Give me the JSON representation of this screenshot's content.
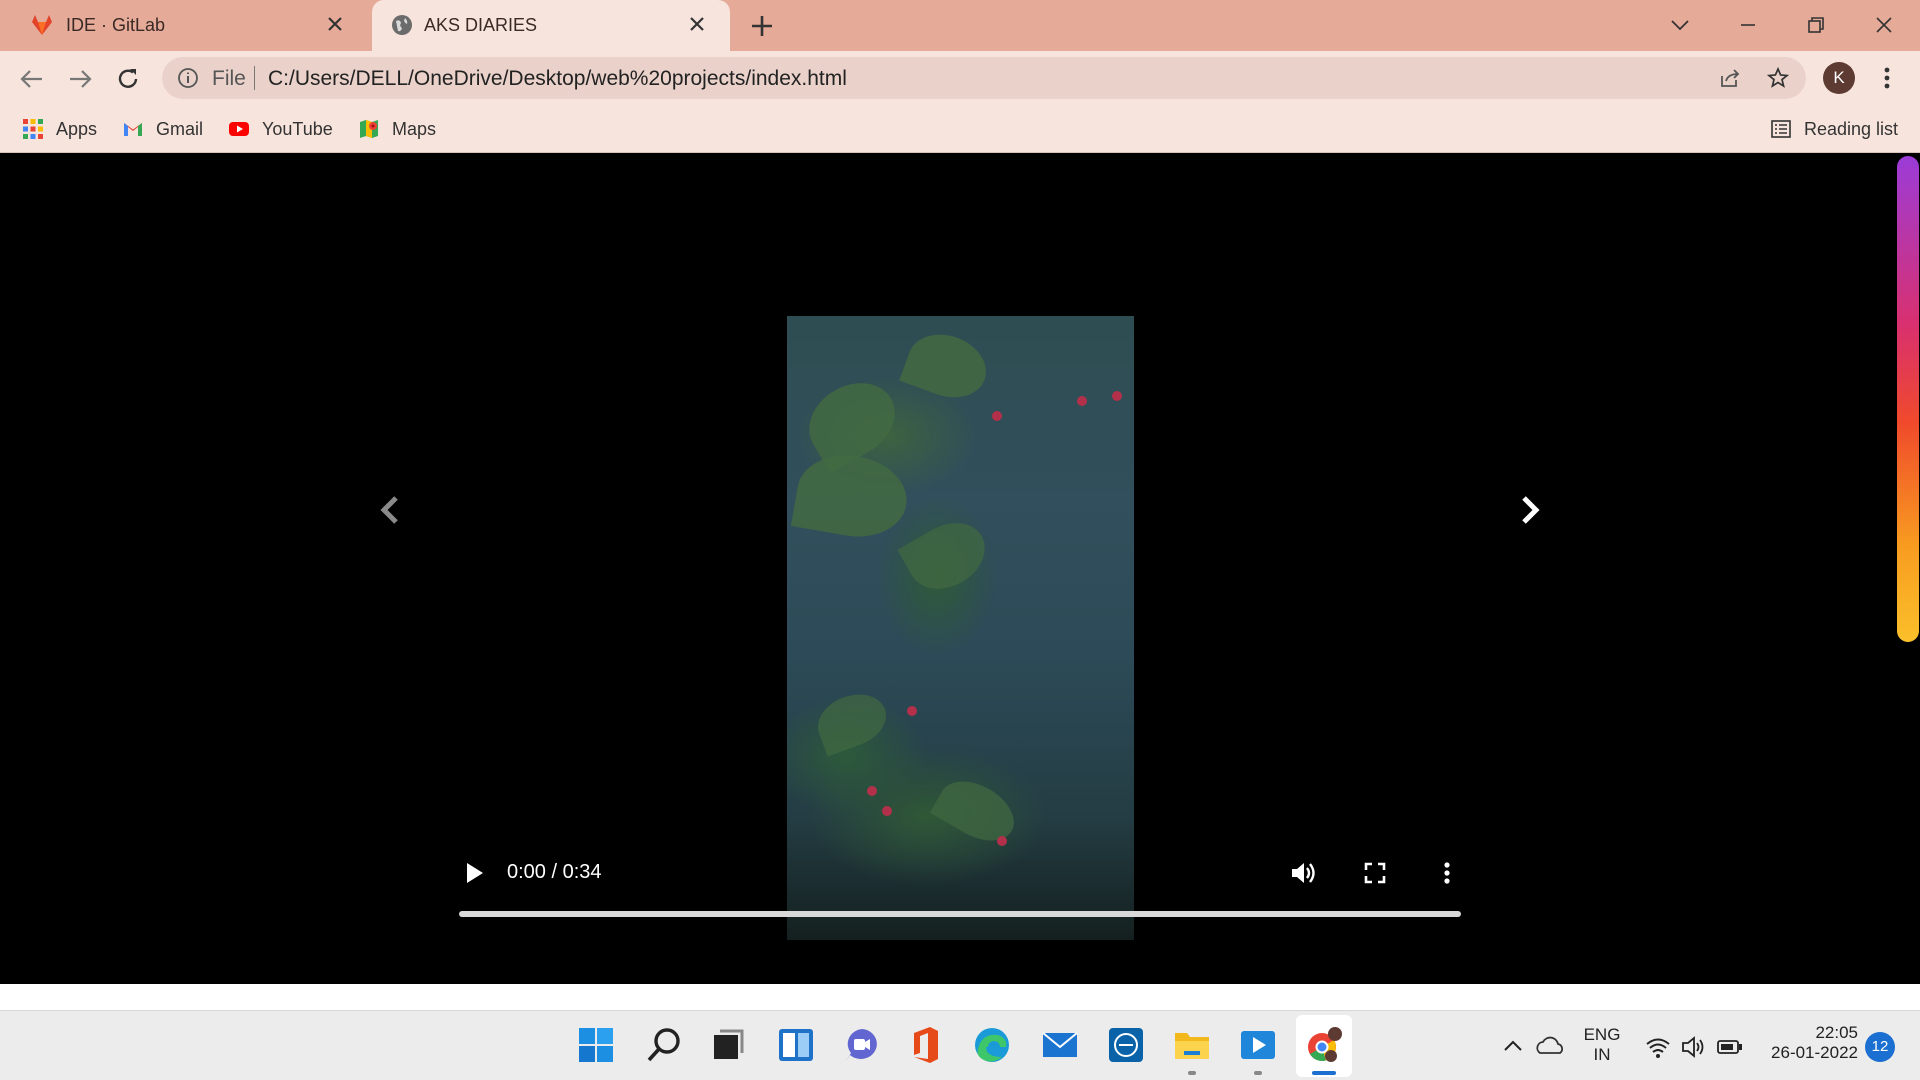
{
  "tabs": [
    {
      "title": "IDE · GitLab",
      "favicon": "gitlab-icon",
      "active": false
    },
    {
      "title": "AKS DIARIES",
      "favicon": "globe-icon",
      "active": true
    }
  ],
  "address_bar": {
    "scheme_label": "File",
    "url": "C:/Users/DELL/OneDrive/Desktop/web%20projects/index.html"
  },
  "profile": {
    "initial": "K"
  },
  "bookmarks": [
    {
      "label": "Apps",
      "icon": "apps-grid-icon"
    },
    {
      "label": "Gmail",
      "icon": "gmail-icon"
    },
    {
      "label": "YouTube",
      "icon": "youtube-icon"
    },
    {
      "label": "Maps",
      "icon": "maps-icon"
    }
  ],
  "reading_list": {
    "label": "Reading list"
  },
  "video": {
    "current_time": "0:00",
    "separator": " / ",
    "duration": "0:34",
    "progress": 0.0
  },
  "taskbar": {
    "apps": [
      "start-icon",
      "search-icon",
      "task-view-icon",
      "widgets-icon",
      "teams-chat-icon",
      "office-icon",
      "edge-icon",
      "mail-icon",
      "dell-icon",
      "file-explorer-icon",
      "media-player-icon",
      "chrome-icon"
    ]
  },
  "tray": {
    "language_top": "ENG",
    "language_bottom": "IN",
    "time": "22:05",
    "date": "26-01-2022",
    "notifications": "12"
  },
  "colors": {
    "tab_strip": "#e6aa98",
    "toolbar": "#f7e4dd",
    "accent_blue": "#1a6fd0"
  }
}
